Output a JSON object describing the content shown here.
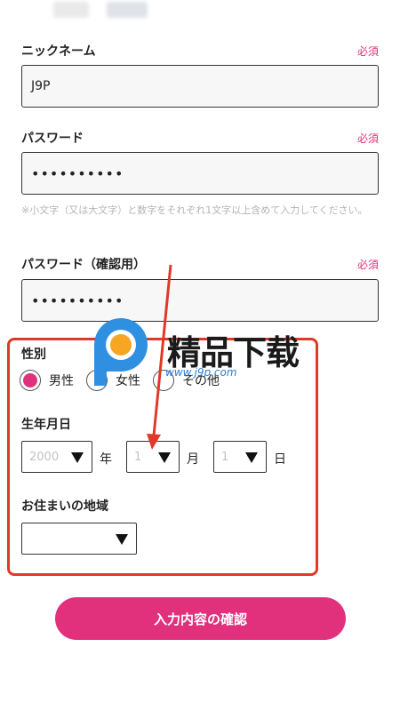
{
  "form": {
    "required_label": "必須",
    "nickname": {
      "label": "ニックネーム",
      "value": "J9P"
    },
    "password": {
      "label": "パスワード",
      "value": "••••••••••"
    },
    "password_hint": "※小文字（又は大文字）と数字をそれぞれ1文字以上含めて入力してください。",
    "password_confirm": {
      "label": "パスワード（確認用）",
      "value": "••••••••••"
    },
    "gender": {
      "label": "性別",
      "options": [
        "男性",
        "女性",
        "その他"
      ],
      "selected": "男性"
    },
    "birthdate": {
      "label": "生年月日",
      "year": {
        "value": "2000",
        "unit": "年"
      },
      "month": {
        "value": "1",
        "unit": "月"
      },
      "day": {
        "value": "1",
        "unit": "日"
      }
    },
    "region": {
      "label": "お住まいの地域",
      "value": ""
    },
    "submit_label": "入力内容の確認"
  },
  "watermark": {
    "text": "精品下载",
    "url": "www.j9p.com"
  },
  "colors": {
    "accent": "#e1307c",
    "annotation": "#e0392a"
  }
}
